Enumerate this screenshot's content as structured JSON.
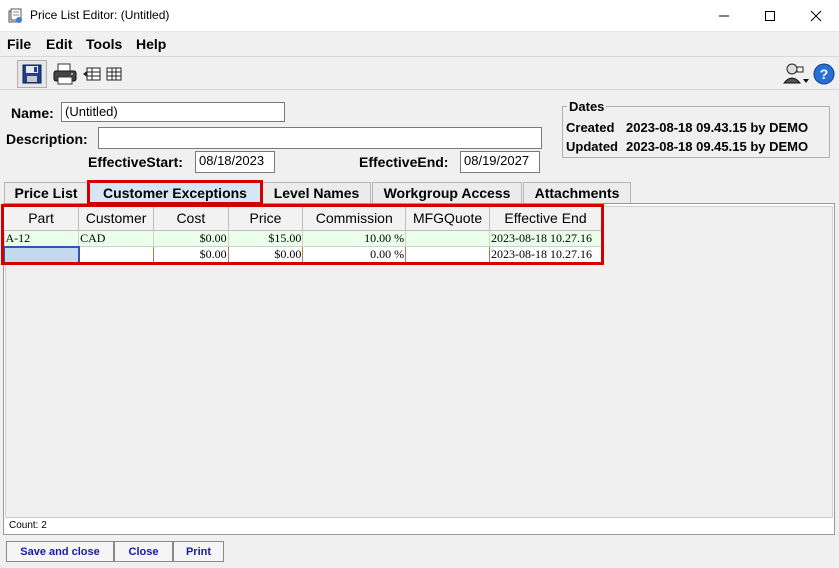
{
  "window": {
    "title": "Price List Editor: (Untitled)"
  },
  "menu": [
    "File",
    "Edit",
    "Tools",
    "Help"
  ],
  "toolbar": {
    "icons": [
      "floppy-save-icon",
      "printer-icon",
      "table-export-icon",
      "table-grid-icon",
      "user-wizard-icon",
      "help-icon"
    ]
  },
  "form": {
    "name_label": "Name:",
    "name_value": "(Untitled)",
    "description_label": "Description:",
    "description_value": "",
    "eff_start_label": "EffectiveStart:",
    "eff_start_value": "08/18/2023",
    "eff_end_label": "EffectiveEnd:",
    "eff_end_value": "08/19/2027"
  },
  "dates": {
    "title": "Dates",
    "created_label": "Created",
    "created_value": "2023-08-18 09.43.15 by DEMO",
    "updated_label": "Updated",
    "updated_value": "2023-08-18 09.45.15 by DEMO"
  },
  "tabs": [
    "Price List",
    "Customer Exceptions",
    "Level Names",
    "Workgroup Access",
    "Attachments"
  ],
  "active_tab": "Customer Exceptions",
  "table": {
    "columns": [
      "Part",
      "Customer",
      "Cost",
      "Price",
      "Commission",
      "MFGQuote",
      "Effective End"
    ],
    "rows": [
      [
        "A-12",
        "CAD",
        "$0.00",
        "$15.00",
        "10.00 %",
        "",
        "2023-08-18 10.27.16"
      ],
      [
        "",
        "",
        "$0.00",
        "$0.00",
        "0.00 %",
        "",
        "2023-08-18 10.27.16"
      ]
    ]
  },
  "status": {
    "count": "Count: 2"
  },
  "buttons": {
    "save_close": "Save and close",
    "close": "Close",
    "print": "Print"
  },
  "colors": {
    "highlight": "#d40000",
    "active_tab": "#d6e6f5",
    "new_row": "#eaffea",
    "button_text": "#1a1aa6"
  }
}
